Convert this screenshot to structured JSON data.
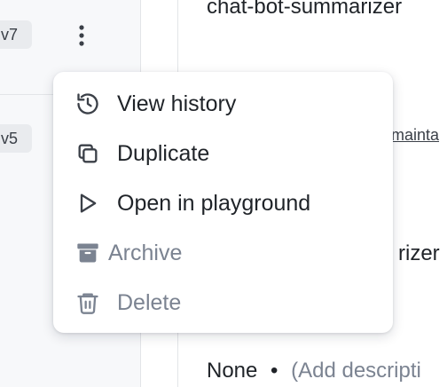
{
  "list": {
    "rows": [
      {
        "version": "v7"
      },
      {
        "version": "v5"
      }
    ]
  },
  "details": {
    "title": "chat-bot-summarizer",
    "owner_link": "mainta",
    "name_fragment": "rizer",
    "description": {
      "value": "None",
      "bullet": "•",
      "placeholder": "(Add descripti"
    }
  },
  "menu": {
    "items": [
      {
        "label": "View history",
        "icon": "history-icon"
      },
      {
        "label": "Duplicate",
        "icon": "duplicate-icon"
      },
      {
        "label": "Open in playground",
        "icon": "play-icon"
      },
      {
        "label": "Archive",
        "icon": "archive-icon"
      },
      {
        "label": "Delete",
        "icon": "trash-icon"
      }
    ]
  },
  "colors": {
    "text": "#1f2328",
    "muted": "#7b8391",
    "panel_bg": "#f7f8fa",
    "badge_bg": "#e9ebee",
    "border": "#e3e5e8"
  }
}
